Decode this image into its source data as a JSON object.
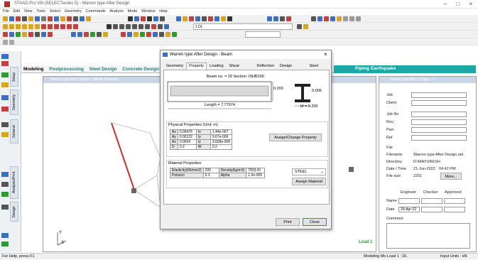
{
  "app": {
    "title": "STAAD.Pro V8i (SELECTseries 5) - Warren type After Design"
  },
  "menu": [
    "File",
    "Edit",
    "View",
    "Tools",
    "Select",
    "Geometry",
    "Commands",
    "Analyze",
    "Mode",
    "Window",
    "Help"
  ],
  "toolbar": {
    "unit_combo": "1 DL"
  },
  "page_tabs": [
    "Modeling",
    "Postprocessing",
    "Steel Design",
    "Concrete Design"
  ],
  "right_tabs": {
    "piping": "Piping",
    "earthquake": "Earthquake"
  },
  "side_tabs": [
    "Setup",
    "Geometry",
    "General",
    "Analysis/Print",
    "Design"
  ],
  "main_window": {
    "title": "Warren type After Design - Whole Structure"
  },
  "right_window": {
    "title": "Warren type After Design - 1",
    "fields": {
      "job": "Job",
      "client": "Client",
      "job_no": "Job No",
      "rev": "Rev.",
      "part": "Part",
      "ref": "Ref",
      "file": "File"
    },
    "filename_label": "Filename",
    "filename": "Warren type After Design.std",
    "directory_label": "Directory",
    "directory": "D:\\MAYURESH",
    "datetime_label": "Date / Time",
    "date": "21-Jun-2022",
    "time": "04:42 PM",
    "filesize_label": "File size",
    "filesize": "2251",
    "more": "More...",
    "sign_headers": [
      "Engineer",
      "Checker",
      "Approved"
    ],
    "name_label": "Name",
    "date_label": "Date",
    "date_value": "25-Apr-22",
    "comment_label": "Comment"
  },
  "load_label": "Load 1",
  "status": {
    "left": "For Help, press F1",
    "mid": "Modeling Mo Load 1 : DL",
    "right": "Input Units : kN"
  },
  "dialog": {
    "title": "Warren type After Design - Beam",
    "tabs": [
      "Geometry",
      "Property",
      "Loading",
      "Shear Bending",
      "Deflection",
      "Design Property",
      "Steel Design"
    ],
    "active_tab": "Property",
    "beam_info": "Beam no. = 29  Section: ISHB200",
    "length": "Length = 7.77074",
    "depth": "0.200",
    "tw": "0.006",
    "bf": "bf = 0.200",
    "physical_title": "Physical Properties (Unit: m)",
    "physical": [
      [
        "Ax",
        "0.00475",
        "Ix",
        "1.44e-007"
      ],
      [
        "Ay",
        "0.00122",
        "Iy",
        "9.67e-006"
      ],
      [
        "Az",
        "0.0024",
        "Iz",
        "3.609e-005"
      ],
      [
        "D",
        "0.2",
        "W",
        "0.2"
      ]
    ],
    "assign_property": "Assign/Change Property",
    "material_title": "Material Properties",
    "material": [
      [
        "Elasticity(kN/mm2)",
        "205",
        "Density(kg/m3)",
        "7833.41"
      ],
      [
        "Poisson",
        "0.3",
        "Alpha",
        "1.2e-005"
      ]
    ],
    "material_select": "STEEL",
    "assign_material": "Assign Material",
    "print": "Print",
    "close": "Close"
  }
}
